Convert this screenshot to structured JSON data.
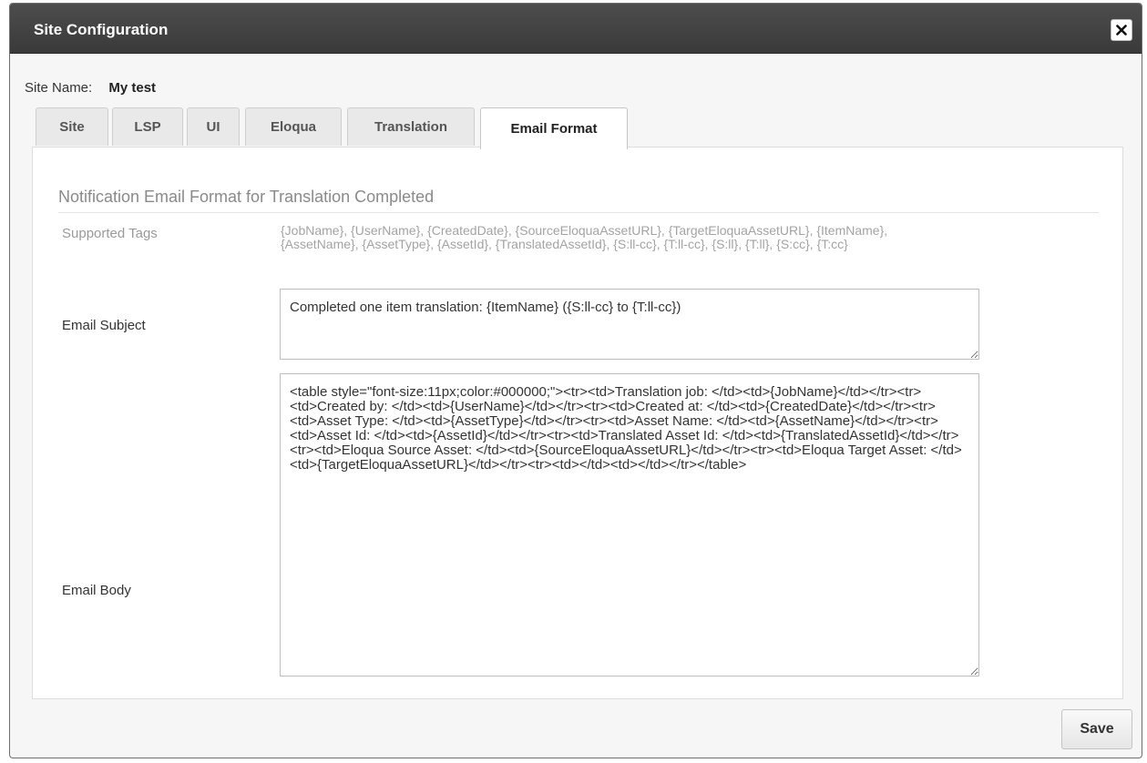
{
  "dialog": {
    "title": "Site Configuration",
    "close_icon": "close-icon"
  },
  "site_name": {
    "label": "Site Name:",
    "value": "My test"
  },
  "tabs": [
    {
      "label": "Site",
      "active": false
    },
    {
      "label": "LSP",
      "active": false
    },
    {
      "label": "UI",
      "active": false
    },
    {
      "label": "Eloqua",
      "active": false
    },
    {
      "label": "Translation",
      "active": false
    },
    {
      "label": "Email Format",
      "active": true
    }
  ],
  "section": {
    "title": "Notification Email Format for Translation Completed",
    "supported_tags_label": "Supported Tags",
    "supported_tags_value": "{JobName}, {UserName}, {CreatedDate}, {SourceEloquaAssetURL}, {TargetEloquaAssetURL}, {ItemName}, {AssetName}, {AssetType}, {AssetId}, {TranslatedAssetId}, {S:ll-cc}, {T:ll-cc}, {S:ll}, {T:ll}, {S:cc}, {T:cc}",
    "email_subject_label": "Email Subject",
    "email_subject_value": "Completed one item translation: {ItemName} ({S:ll-cc} to {T:ll-cc})",
    "email_body_label": "Email Body",
    "email_body_value": "<table style=\"font-size:11px;color:#000000;\"><tr><td>Translation job: </td><td>{JobName}</td></tr><tr><td>Created by: </td><td>{UserName}</td></tr><tr><td>Created at: </td><td>{CreatedDate}</td></tr><tr><td>Asset Type: </td><td>{AssetType}</td></tr><tr><td>Asset Name: </td><td>{AssetName}</td></tr><tr><td>Asset Id: </td><td>{AssetId}</td></tr><tr><td>Translated Asset Id: </td><td>{TranslatedAssetId}</td></tr><tr><td>Eloqua Source Asset: </td><td>{SourceEloquaAssetURL}</td></tr><tr><td>Eloqua Target Asset: </td><td>{TargetEloquaAssetURL}</td></tr><tr><td></td><td></td></tr></table>"
  },
  "footer": {
    "save_label": "Save"
  }
}
